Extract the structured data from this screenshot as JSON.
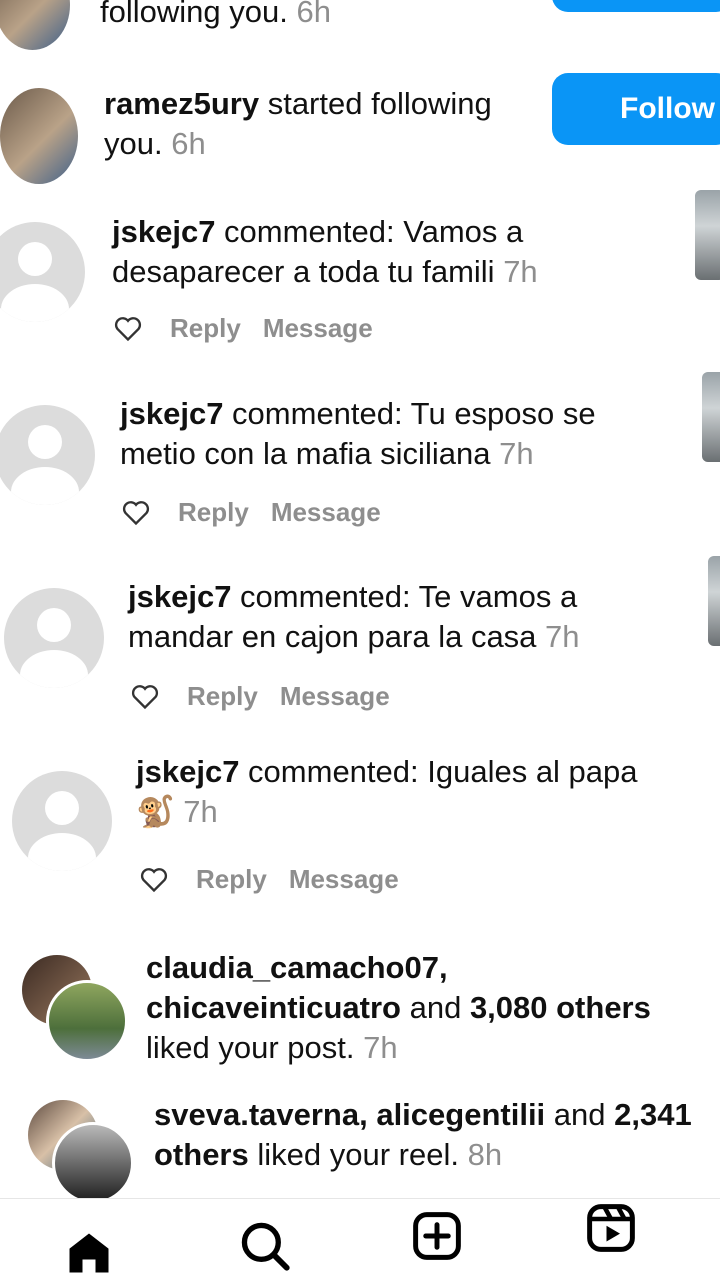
{
  "notifications": [
    {
      "type": "follow_partial",
      "text": "following you.",
      "time": "6h"
    },
    {
      "type": "follow",
      "username": "ramez5ury",
      "text": " started following you.",
      "time": "6h",
      "button": "Follow"
    },
    {
      "type": "comment",
      "username": "jskejc7",
      "text": " commented: Vamos a desaparecer a toda tu famili",
      "time": "7h",
      "reply": "Reply",
      "message": "Message"
    },
    {
      "type": "comment",
      "username": "jskejc7",
      "text": " commented: Tu esposo se metio con la mafia siciliana",
      "time": "7h",
      "reply": "Reply",
      "message": "Message"
    },
    {
      "type": "comment",
      "username": "jskejc7",
      "text": " commented: Te vamos a mandar en cajon para la casa",
      "time": "7h",
      "reply": "Reply",
      "message": "Message"
    },
    {
      "type": "comment",
      "username": "jskejc7",
      "text": " commented: Iguales al papa",
      "emoji": "🐒",
      "time": "7h",
      "reply": "Reply",
      "message": "Message"
    },
    {
      "type": "like",
      "users": "claudia_camacho07, chicaveinticuatro",
      "mid": " and ",
      "others": "3,080 others",
      "tail": " liked your post.",
      "time": "7h"
    },
    {
      "type": "like",
      "users": "sveva.taverna, alicegentilii",
      "mid": " and ",
      "others": "2,341 others",
      "tail": " liked your reel.",
      "time": "8h"
    }
  ],
  "nav": {
    "icons": [
      "home-icon",
      "search-icon",
      "create-icon",
      "reels-icon"
    ]
  },
  "colors": {
    "accent": "#0a95f6",
    "muted": "#8e8e8e"
  }
}
